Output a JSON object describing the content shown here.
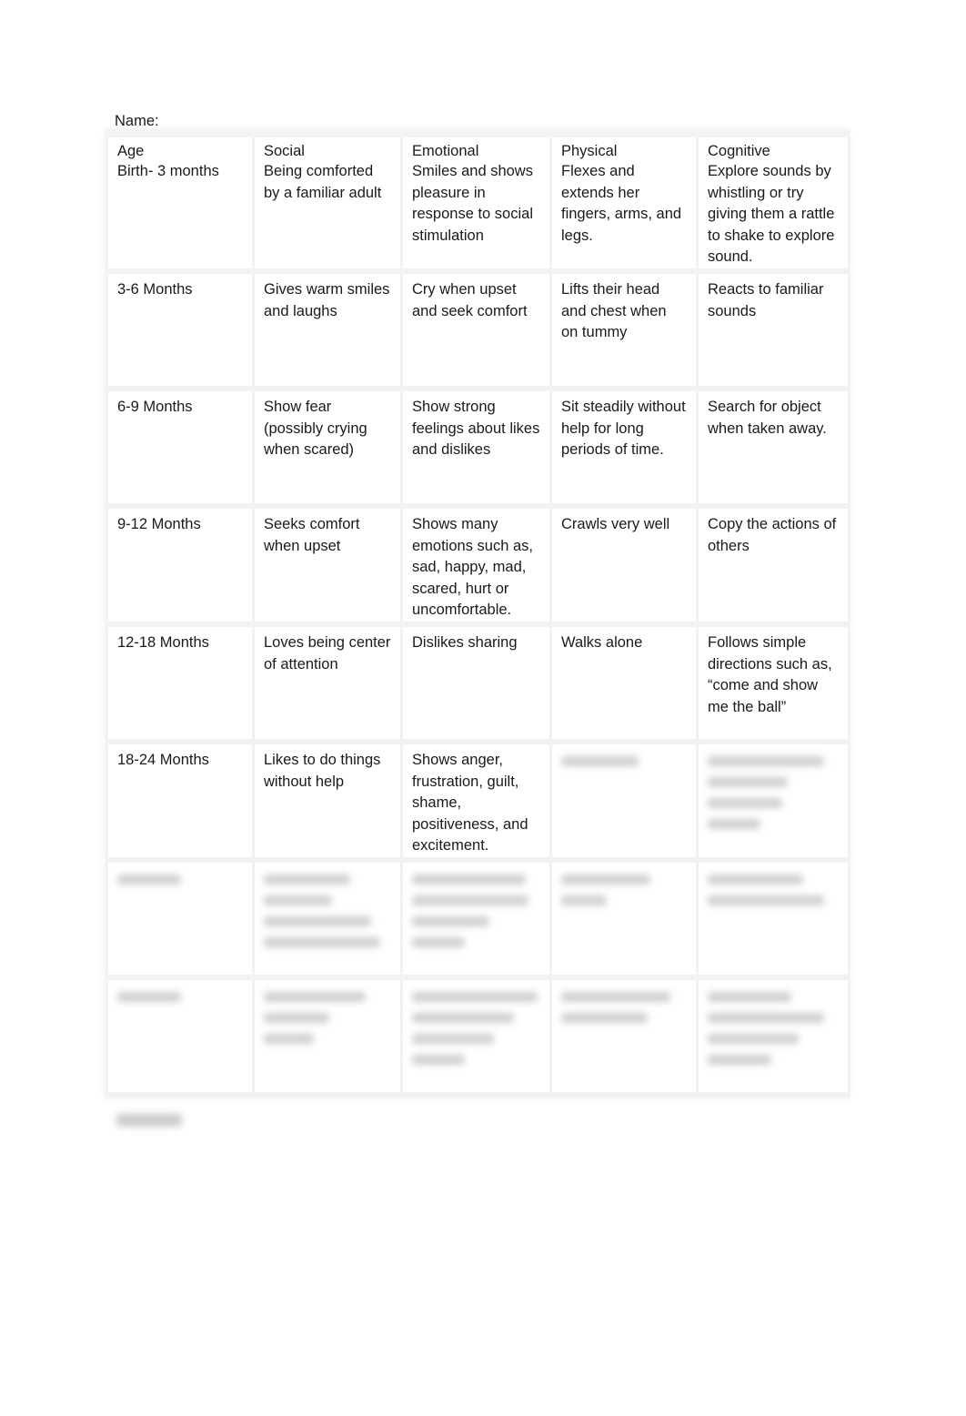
{
  "document": {
    "name_label": "Name:",
    "columns": [
      "Age",
      "Social",
      "Emotional",
      "Physical",
      "Cognitive"
    ],
    "rows": [
      {
        "age": "Birth- 3 months",
        "social": "Being comforted by a familiar adult",
        "emotional": "Smiles and shows pleasure in response to social stimulation",
        "physical": "Flexes and extends her fingers, arms, and legs.",
        "cognitive": "Explore sounds by whistling or try giving them a rattle to shake to explore sound."
      },
      {
        "age": "3-6 Months",
        "social": "Gives warm smiles and laughs",
        "emotional": "Cry when upset and seek comfort",
        "physical": "Lifts their head and chest when on tummy",
        "cognitive": "Reacts to familiar sounds"
      },
      {
        "age": "6-9 Months",
        "social": "Show fear (possibly crying when scared)",
        "emotional": "Show strong feelings about likes and dislikes",
        "physical": "Sit steadily without help for long periods of time.",
        "cognitive": "Search for object when taken away."
      },
      {
        "age": "9-12 Months",
        "social": "Seeks comfort when upset",
        "emotional": "Shows many emotions such as, sad, happy, mad, scared, hurt or uncomfortable.",
        "physical": "Crawls very well",
        "cognitive": "Copy the actions of others"
      },
      {
        "age": "12-18 Months",
        "social": "Loves being center of attention",
        "emotional": "Dislikes sharing",
        "physical": "Walks alone",
        "cognitive": "Follows simple directions such as, “come and show me the ball”"
      },
      {
        "age": "18-24 Months",
        "social": "Likes to do things without help",
        "emotional": "Shows anger, frustration, guilt, shame, positiveness, and excitement.",
        "physical": "",
        "cognitive": ""
      }
    ],
    "obscured_note": "Remaining cells and rows are blurred and unreadable in the screenshot"
  }
}
